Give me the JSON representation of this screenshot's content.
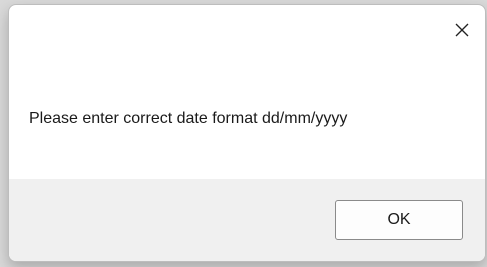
{
  "dialog": {
    "message": "Please enter correct date format dd/mm/yyyy",
    "ok_label": "OK",
    "close_icon": "close-icon"
  },
  "colors": {
    "footer_bg": "#f0f0f0",
    "dialog_bg": "#ffffff",
    "button_border": "#8a8a8a"
  }
}
